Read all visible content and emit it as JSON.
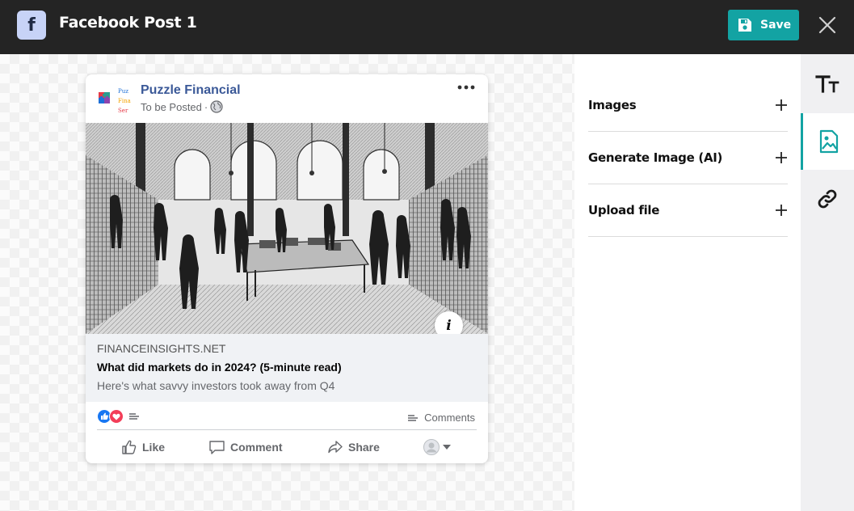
{
  "header": {
    "badge_letter": "f",
    "title": "Facebook Post 1",
    "save_label": "Save"
  },
  "post": {
    "page_name": "Puzzle Financial",
    "status": "To be Posted",
    "status_separator": "·",
    "link": {
      "domain": "FINANCEINSIGHTS.NET",
      "title": "What did markets do in 2024? (5-minute read)",
      "description": "Here's what savvy investors took away from Q4"
    },
    "info_label": "i",
    "comments_label": "Comments",
    "actions": {
      "like": "Like",
      "comment": "Comment",
      "share": "Share"
    },
    "avatar_logo_lines": [
      "Puz",
      "Fina",
      "Ser"
    ]
  },
  "panel": {
    "items": [
      {
        "label": "Images"
      },
      {
        "label": "Generate Image (AI)"
      },
      {
        "label": "Upload file"
      }
    ]
  },
  "rail": {
    "items": [
      "text-icon",
      "image-icon",
      "link-icon"
    ],
    "active": "image-icon"
  },
  "colors": {
    "accent": "#13a3a3",
    "topbar": "#242424",
    "facebook_blue": "#3b5998",
    "like_blue": "#1877f2",
    "love_red": "#f33e58"
  }
}
